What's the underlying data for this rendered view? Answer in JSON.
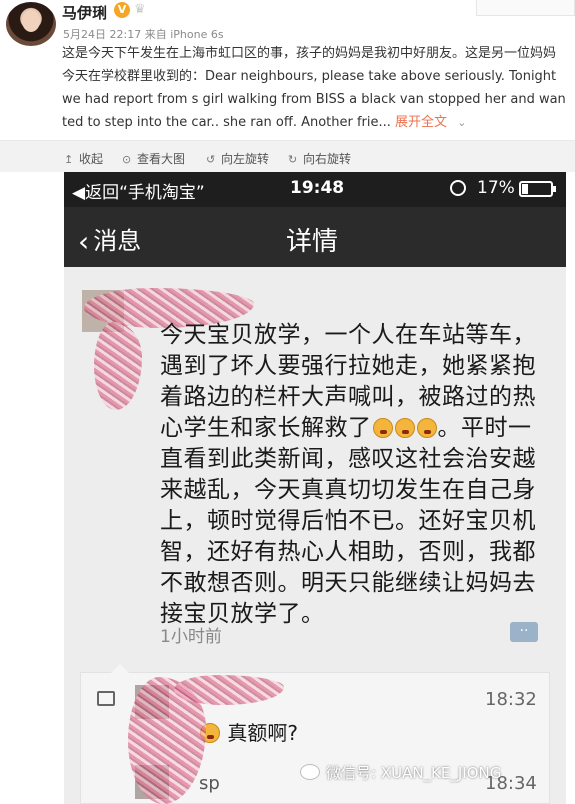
{
  "post": {
    "author": "马伊琍",
    "verified_badge": "V",
    "date": "5月24日 22:17",
    "source_prefix": "来自",
    "source": "iPhone 6s",
    "text": "这是今天下午发生在上海市虹口区的事，孩子的妈妈是我初中好朋友。这是另一位妈妈今天在学校群里收到的：Dear neighbours, please take above seriously. Tonight  we had report from s girl walking from BISS a black van stopped her and wanted to step into the car.. she ran off. Another frie...",
    "expand_label": "展开全文",
    "expand_icon": "chevron-down-icon"
  },
  "toolbar": {
    "items": [
      {
        "label": "收起",
        "icon": "collapse-icon"
      },
      {
        "label": "查看大图",
        "icon": "magnify-icon"
      },
      {
        "label": "向左旋转",
        "icon": "rotate-left-icon"
      },
      {
        "label": "向右旋转",
        "icon": "rotate-right-icon"
      }
    ]
  },
  "screenshot": {
    "status": {
      "back_app": "◀返回“手机淘宝”",
      "time": "19:48",
      "battery": "17%"
    },
    "nav": {
      "back_label": "消息",
      "title": "详情"
    },
    "moment": {
      "text_before": "今天宝贝放学，一个人在车站等车，遇到了坏人要强行拉她走，她紧紧抱着路边的栏杆大声喊叫，被路过的热心学生和家长解救了",
      "text_after": "。平时一直看到此类新闻，感叹这社会治安越来越乱，今天真真切切发生在自己身上，顿时觉得后怕不已。还好宝贝机智，还好有热心人相助，否则，我都不敢想否则。明天只能继续让妈妈去接宝贝放学了。",
      "time": "1小时前"
    },
    "comments": [
      {
        "time": "18:32",
        "text": "真额啊?"
      },
      {
        "time": "18:34",
        "name_fragment": "sp"
      }
    ]
  },
  "watermark": "微信号: XUAN_KE_JIONG",
  "colors": {
    "accent": "#eb7350",
    "verified": "#f6a623",
    "status_bar": "#1e1e1e",
    "nav_bar": "#2b2b2b"
  }
}
